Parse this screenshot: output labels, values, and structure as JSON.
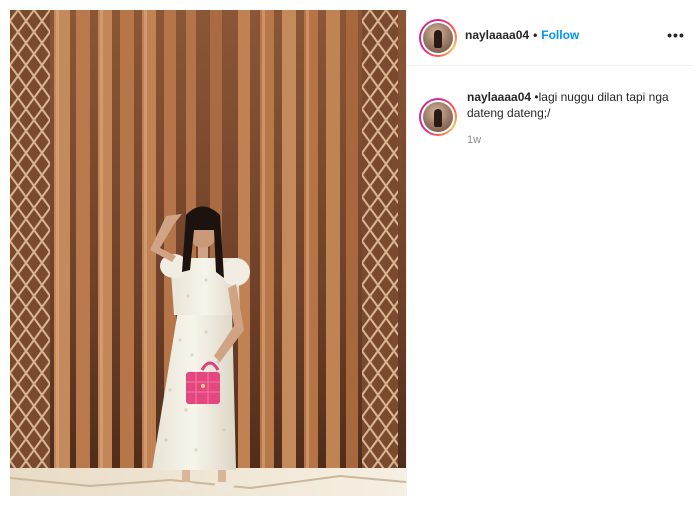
{
  "post": {
    "username": "naylaaaa04",
    "separator": "•",
    "follow_label": "Follow",
    "more_label": "•••",
    "caption": {
      "username": "naylaaaa04",
      "text": " •lagi nuggu dilan tapi nga dateng dateng;/"
    },
    "timestamp": "1w"
  },
  "icons": {
    "more": "more-options-icon",
    "avatar": "profile-avatar"
  },
  "colors": {
    "follow": "#0095f6",
    "text": "#262626",
    "muted": "#8e8e8e",
    "divider": "#efefef"
  }
}
